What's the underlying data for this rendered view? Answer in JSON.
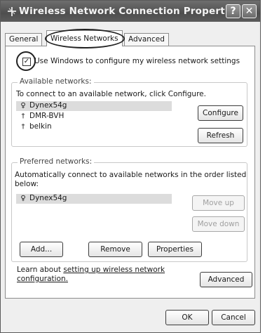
{
  "window": {
    "title": "Wireless Network Connection Properties",
    "help_label": "?",
    "close_label": "✕"
  },
  "tabs": [
    {
      "label": "General"
    },
    {
      "label": "Wireless Networks"
    },
    {
      "label": "Advanced"
    }
  ],
  "use_windows": {
    "checked": true,
    "check_glyph": "✓",
    "label": "Use Windows to configure my wireless network settings"
  },
  "available": {
    "title": "Available networks:",
    "description": "To connect to an available network, click Configure.",
    "networks": [
      {
        "name": "Dynex54g",
        "icon": "antenna-icon",
        "glyph": "♀"
      },
      {
        "name": "DMR-BVH",
        "icon": "adhoc-icon",
        "glyph": "†"
      },
      {
        "name": "belkin",
        "icon": "adhoc-icon",
        "glyph": "†"
      }
    ],
    "configure_label": "Configure",
    "refresh_label": "Refresh"
  },
  "preferred": {
    "title": "Preferred networks:",
    "description_line1": "Automatically connect to available networks in the order listed",
    "description_line2": "below:",
    "networks": [
      {
        "name": "Dynex54g",
        "icon": "antenna-icon",
        "glyph": "♀"
      }
    ],
    "move_up_label": "Move up",
    "move_down_label": "Move down",
    "add_label": "Add...",
    "remove_label": "Remove",
    "properties_label": "Properties"
  },
  "learn": {
    "prefix": "Learn about ",
    "link_line1": "setting up wireless network",
    "link_line2": "configuration."
  },
  "advanced_label": "Advanced",
  "ok_label": "OK",
  "cancel_label": "Cancel"
}
